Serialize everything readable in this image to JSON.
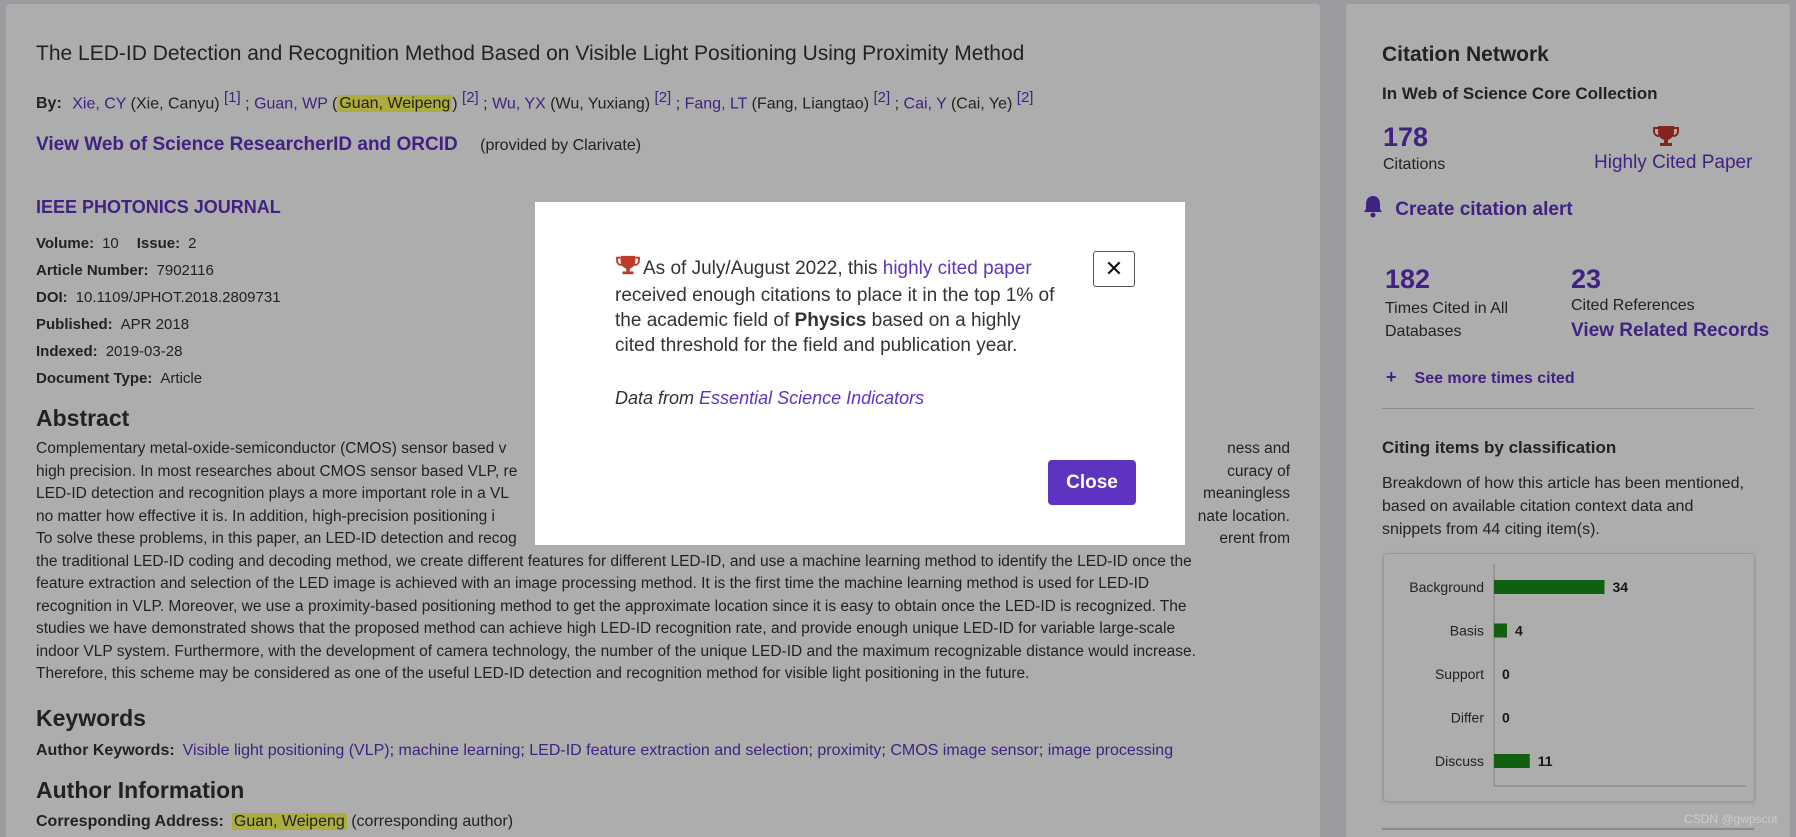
{
  "article": {
    "title": "The LED-ID Detection and Recognition Method Based on Visible Light Positioning Using Proximity Method",
    "by_label": "By:",
    "authors": [
      {
        "short": "Xie, CY",
        "full": "(Xie, Canyu)",
        "ref": "[1]",
        "sep": ";"
      },
      {
        "short": "Guan, WP",
        "full": "Guan, Weipeng",
        "ref": "[2]",
        "sep": ";"
      },
      {
        "short": "Wu, YX",
        "full": "(Wu, Yuxiang)",
        "ref": "[2]",
        "sep": ";"
      },
      {
        "short": "Fang, LT",
        "full": "(Fang, Liangtao)",
        "ref": "[2]",
        "sep": ";"
      },
      {
        "short": "Cai, Y",
        "full": "(Cai, Ye)",
        "ref": "[2]"
      }
    ],
    "orcid_link": "View Web of Science ResearcherID and ORCID",
    "orcid_note": "(provided by Clarivate)",
    "journal": "IEEE PHOTONICS JOURNAL",
    "volume_label": "Volume:",
    "volume": "10",
    "issue_label": "Issue:",
    "issue": "2",
    "article_number_label": "Article Number:",
    "article_number": "7902116",
    "doi_label": "DOI:",
    "doi": "10.1109/JPHOT.2018.2809731",
    "published_label": "Published:",
    "published": "APR 2018",
    "indexed_label": "Indexed:",
    "indexed": "2019-03-28",
    "doctype_label": "Document Type:",
    "doctype": "Article",
    "abstract_heading": "Abstract",
    "abstract_lines": [
      "Complementary metal-oxide-semiconductor (CMOS) sensor based v",
      "high precision. In most researches about CMOS sensor based VLP, re",
      "LED-ID detection and recognition plays a more important role in a VL",
      "no matter how effective it is. In addition, high-precision positioning i",
      "To solve these problems, in this paper, an LED-ID detection and recog",
      "the traditional LED-ID coding and decoding method, we create different features for different LED-ID, and use a machine learning method to identify the LED-ID once the",
      "feature extraction and selection of the LED image is achieved with an image processing method. It is the first time the machine learning method is used for LED-ID",
      "recognition in VLP. Moreover, we use a proximity-based positioning method to get the approximate location since it is easy to obtain once the LED-ID is recognized. The",
      "studies we have demonstrated shows that the proposed method can achieve high LED-ID recognition rate, and provide enough unique LED-ID for variable large-scale",
      "indoor VLP system. Furthermore, with the development of camera technology, the number of the unique LED-ID and the maximum recognizable distance would increase.",
      "Therefore, this scheme may be considered as one of the useful LED-ID detection and recognition method for visible light positioning in the future."
    ],
    "abstract_tails": [
      "ness and",
      "curacy of",
      "meaningless",
      "nate location.",
      "erent from"
    ],
    "keywords_heading": "Keywords",
    "author_keywords_label": "Author Keywords:",
    "keywords": [
      "Visible light positioning (VLP)",
      "machine learning",
      "LED-ID feature extraction and selection",
      "proximity",
      "CMOS image sensor",
      "image processing"
    ],
    "author_info_heading": "Author Information",
    "corr_label": "Corresponding Address:",
    "corr_name": "Guan, Weipeng",
    "corr_note": "(corresponding author)"
  },
  "sidebar": {
    "title": "Citation Network",
    "subtitle": "In Web of Science Core Collection",
    "citations_count": "178",
    "citations_label": "Citations",
    "highly_cited_label": "Highly Cited Paper",
    "alert_label": "Create citation alert",
    "times_cited_count": "182",
    "times_cited_label": "Times Cited in All Databases",
    "cited_refs_count": "23",
    "cited_refs_label": "Cited References",
    "view_related": "View Related Records",
    "see_more": "See more times cited",
    "citing_title": "Citing items by classification",
    "citing_desc": "Breakdown of how this article has been mentioned, based on available citation context data and snippets from 44 citing item(s)."
  },
  "chart_data": {
    "type": "bar",
    "orientation": "horizontal",
    "categories": [
      "Background",
      "Basis",
      "Support",
      "Differ",
      "Discuss"
    ],
    "values": [
      34,
      4,
      0,
      0,
      11
    ],
    "color": "#1a8c1a"
  },
  "modal": {
    "text_pre": "As of July/August 2022, this",
    "link": "highly cited paper",
    "text_mid": "received enough citations to place it in the top 1% of the academic field of",
    "field": "Physics",
    "text_post": "based on a highly cited threshold for the field and publication year.",
    "source_prefix": "Data from",
    "source_link": "Essential Science Indicators",
    "close_x": "✕",
    "close_button": "Close"
  },
  "watermark": "CSDN @gwpscut",
  "colors": {
    "accent": "#5e33bf",
    "highlight": "#ffff5c",
    "trophy": "#c0392b",
    "bar": "#1a8c1a"
  }
}
